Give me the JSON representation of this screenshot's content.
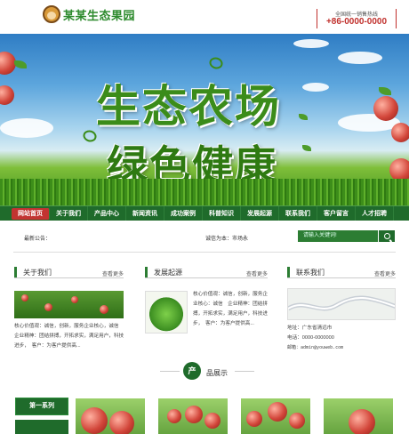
{
  "header": {
    "logo_text": "某某生态果园",
    "hotline_label": "全国统一销售热线",
    "hotline_number": "+86-0000-0000"
  },
  "banner": {
    "line1": "生态农场",
    "line2": "绿色健康"
  },
  "nav": {
    "items": [
      "网站首页",
      "关于我们",
      "产品中心",
      "新闻资讯",
      "成功案例",
      "科普知识",
      "发展起源",
      "联系我们",
      "客户留言",
      "人才招聘"
    ]
  },
  "notice": {
    "label": "最新公告：",
    "text": "诚信为本：市场永"
  },
  "search": {
    "placeholder": "请输入关键词!"
  },
  "about": {
    "title": "关于我们",
    "more": "查看更多",
    "body": "核心价值观：诚信，创新，服务企业核心，诚信　企业精神：团结拼搏，开拓求实，满足用户，科技进步，　客户：为客户提供高..."
  },
  "origin": {
    "title": "发展起源",
    "more": "查看更多",
    "body": "核心价值观：诚信，创新，服务企业核心：诚信　企业精神：团结拼搏，开拓求实，满足用户，科技进步，　客户：为客户提供高..."
  },
  "contact": {
    "title": "联系我们",
    "more": "查看更多",
    "address": "地址：广东省清远市",
    "phone": "电话：0000-0000000",
    "email": "邮箱：admin@youweb.com"
  },
  "products": {
    "badge": "产",
    "title": "品展示",
    "series_label": "第一系列"
  },
  "colors": {
    "primary_green": "#1f6b2b",
    "accent_red": "#c23431"
  }
}
